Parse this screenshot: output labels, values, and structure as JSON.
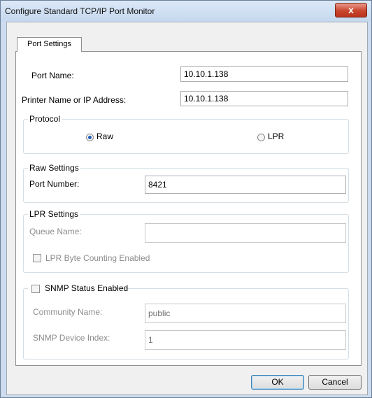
{
  "window": {
    "title": "Configure Standard TCP/IP Port Monitor",
    "close_label": "x"
  },
  "tabs": [
    {
      "label": "Port Settings"
    }
  ],
  "fields": {
    "port_name": {
      "label": "Port Name:",
      "value": "10.10.1.138"
    },
    "printer_name": {
      "label": "Printer Name or IP Address:",
      "value": "10.10.1.138"
    }
  },
  "protocol": {
    "legend": "Protocol",
    "options": [
      {
        "label": "Raw",
        "selected": true
      },
      {
        "label": "LPR",
        "selected": false
      }
    ]
  },
  "raw_settings": {
    "legend": "Raw Settings",
    "port_number_label": "Port Number:",
    "port_number_value": "8421"
  },
  "lpr_settings": {
    "legend": "LPR Settings",
    "queue_name_label": "Queue Name:",
    "queue_name_value": "",
    "byte_counting_label": "LPR Byte Counting Enabled",
    "byte_counting_checked": false
  },
  "snmp": {
    "enabled_label": "SNMP Status Enabled",
    "enabled_checked": false,
    "community_label": "Community Name:",
    "community_value": "public",
    "device_index_label": "SNMP Device Index:",
    "device_index_value": "1"
  },
  "buttons": {
    "ok": "OK",
    "cancel": "Cancel"
  }
}
